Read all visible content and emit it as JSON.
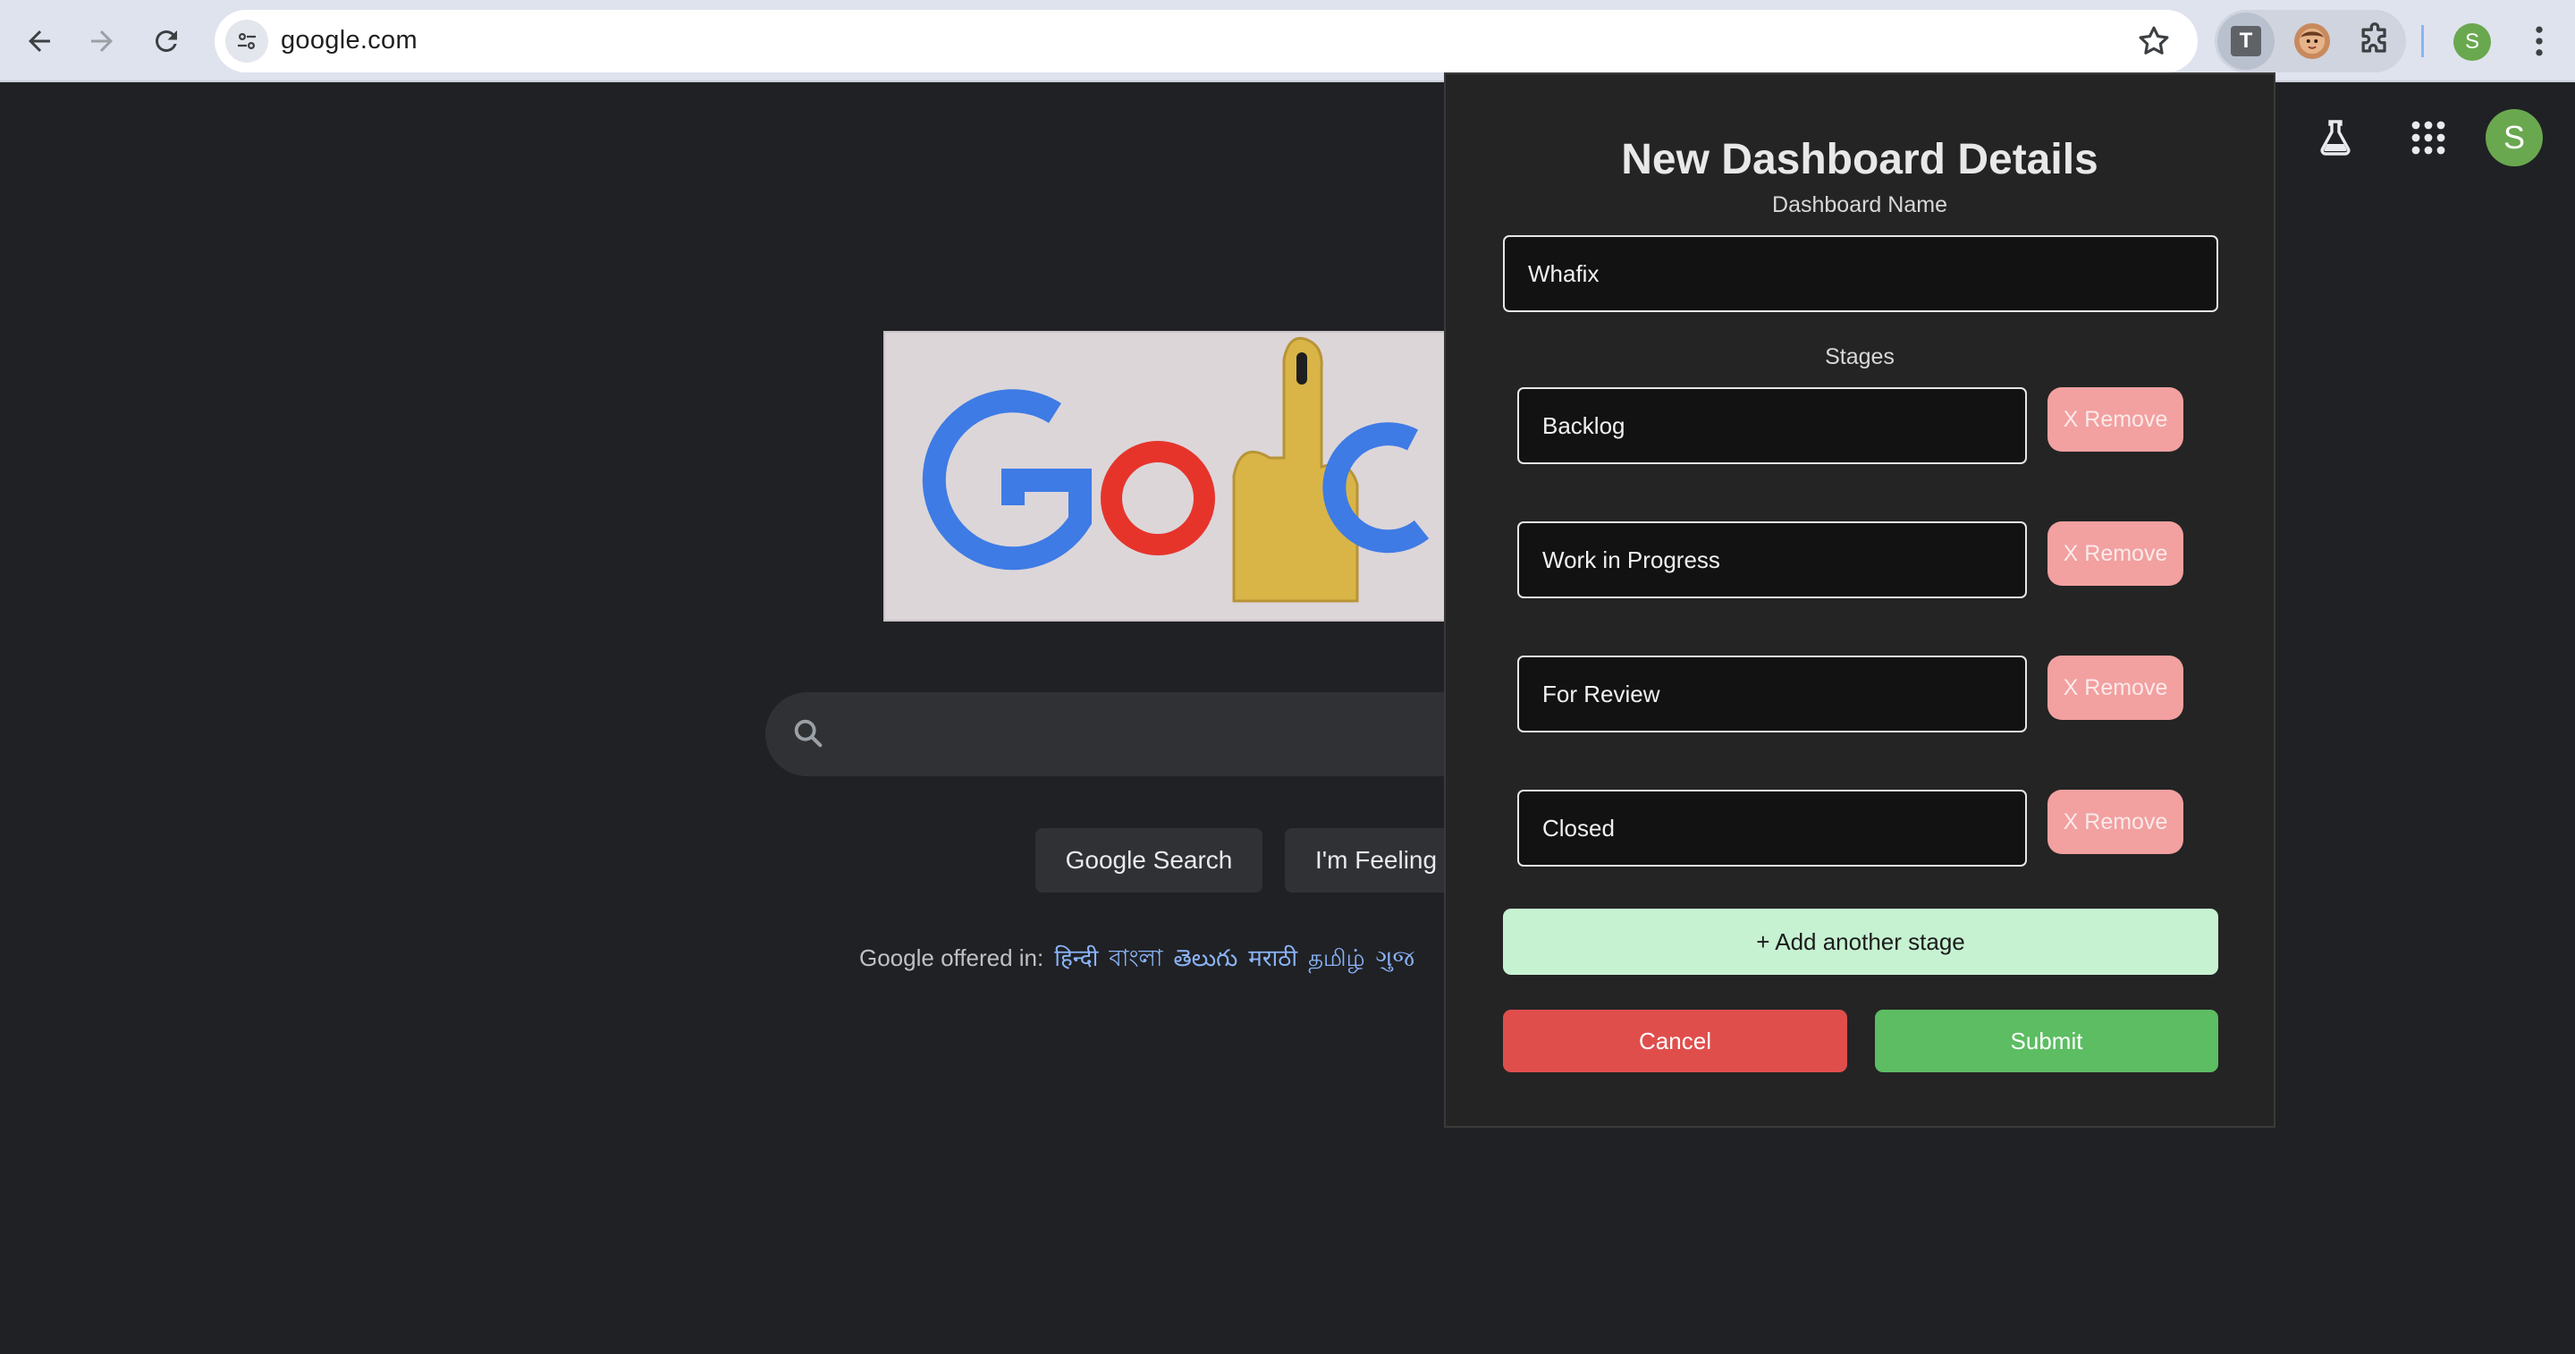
{
  "browser": {
    "url": "google.com",
    "extension_t_letter": "T",
    "profile_initial": "S"
  },
  "google": {
    "avatar_initial": "S",
    "search_button": "Google Search",
    "lucky_button": "I'm Feeling",
    "offered_in_label": "Google offered in:",
    "languages": [
      "हिन्दी",
      "বাংলা",
      "తెలుగు",
      "मराठी",
      "தமிழ்",
      "ગુજ"
    ]
  },
  "popup": {
    "title": "New Dashboard Details",
    "dashboard_name_label": "Dashboard Name",
    "dashboard_name_value": "Whafix",
    "stages_label": "Stages",
    "stages": [
      {
        "value": "Backlog",
        "remove_label": "X Remove"
      },
      {
        "value": "Work in Progress",
        "remove_label": "X Remove"
      },
      {
        "value": "For Review",
        "remove_label": "X Remove"
      },
      {
        "value": "Closed",
        "remove_label": "X Remove"
      }
    ],
    "add_stage_label": "+ Add another stage",
    "cancel_label": "Cancel",
    "submit_label": "Submit"
  },
  "icons": {
    "back": "arrow-left-icon",
    "forward": "arrow-right-icon",
    "reload": "reload-icon",
    "site_info": "tune-icon",
    "bookmark": "star-icon",
    "extensions": "puzzle-icon",
    "menu": "kebab-icon",
    "labs": "flask-icon",
    "apps": "grid-icon",
    "search": "search-icon"
  },
  "colors": {
    "page_bg": "#202124",
    "popup_bg": "#242424",
    "remove": "#f2a0a0",
    "add_stage": "#c6f2d2",
    "cancel": "#e04e4c",
    "submit": "#5cbd62",
    "link": "#8ab4f8"
  }
}
